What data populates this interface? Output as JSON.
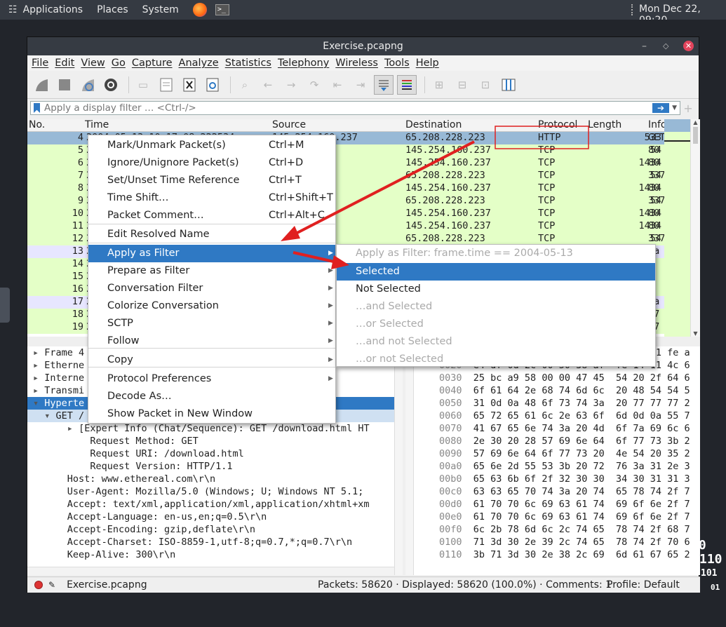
{
  "topbar": {
    "apps": "Applications",
    "places": "Places",
    "system": "System",
    "clock": "Mon Dec 22, 09:20"
  },
  "window": {
    "title": "Exercise.pcapng"
  },
  "menubar": [
    "File",
    "Edit",
    "View",
    "Go",
    "Capture",
    "Analyze",
    "Statistics",
    "Telephony",
    "Wireless",
    "Tools",
    "Help"
  ],
  "filter": {
    "placeholder": "Apply a display filter … <Ctrl-/>"
  },
  "columns": {
    "no": "No.",
    "time": "Time",
    "source": "Source",
    "destination": "Destination",
    "protocol": "Protocol",
    "length": "Length",
    "info": "Info"
  },
  "packets": [
    {
      "no": "4",
      "time": "2004-05-13 10:17:08.222534",
      "src": "145.254.160.237",
      "dst": "65.208.228.223",
      "proto": "HTTP",
      "len": "533",
      "info": "GET",
      "kind": "sel"
    },
    {
      "no": "5",
      "time": "2",
      "src": ".223",
      "dst": "145.254.160.237",
      "proto": "TCP",
      "len": "54",
      "info": "80",
      "kind": "http"
    },
    {
      "no": "6",
      "time": "2",
      "src": ".223",
      "dst": "145.254.160.237",
      "proto": "TCP",
      "len": "1434",
      "info": "80",
      "kind": "http"
    },
    {
      "no": "7",
      "time": "2",
      "src": "0.237",
      "dst": "65.208.228.223",
      "proto": "TCP",
      "len": "54",
      "info": "337",
      "kind": "http"
    },
    {
      "no": "8",
      "time": "2",
      "src": ".223",
      "dst": "145.254.160.237",
      "proto": "TCP",
      "len": "1434",
      "info": "80",
      "kind": "http"
    },
    {
      "no": "9",
      "time": "2",
      "src": "0.237",
      "dst": "65.208.228.223",
      "proto": "TCP",
      "len": "54",
      "info": "337",
      "kind": "http"
    },
    {
      "no": "10",
      "time": "2",
      "src": ".223",
      "dst": "145.254.160.237",
      "proto": "TCP",
      "len": "1434",
      "info": "80",
      "kind": "http"
    },
    {
      "no": "11",
      "time": "2",
      "src": ".223",
      "dst": "145.254.160.237",
      "proto": "TCP",
      "len": "1434",
      "info": "80",
      "kind": "http"
    },
    {
      "no": "12",
      "time": "2",
      "src": "0.237",
      "dst": "65.208.228.223",
      "proto": "TCP",
      "len": "54",
      "info": "337",
      "kind": "http"
    },
    {
      "no": "13",
      "time": "2",
      "src": "",
      "dst": "",
      "proto": "",
      "len": "",
      "info": "ta",
      "kind": "tcp"
    },
    {
      "no": "14",
      "time": "2",
      "src": "",
      "dst": "",
      "proto": "",
      "len": "",
      "info": "9",
      "kind": "http"
    },
    {
      "no": "15",
      "time": "2",
      "src": "",
      "dst": "",
      "proto": "",
      "len": "",
      "info": "0",
      "kind": "http"
    },
    {
      "no": "16",
      "time": "2",
      "src": "",
      "dst": "",
      "proto": "",
      "len": "",
      "info": "0",
      "kind": "http"
    },
    {
      "no": "17",
      "time": "2",
      "src": "",
      "dst": "",
      "proto": "",
      "len": "",
      "info": "ta",
      "kind": "tcp"
    },
    {
      "no": "18",
      "time": "2",
      "src": "",
      "dst": "",
      "proto": "",
      "len": "",
      "info": "37",
      "kind": "http"
    },
    {
      "no": "19",
      "time": "2",
      "src": "",
      "dst": "",
      "proto": "",
      "len": "",
      "info": "37",
      "kind": "http"
    }
  ],
  "details": [
    {
      "indent": "",
      "arrow": "▸",
      "text": "Frame 4"
    },
    {
      "indent": "",
      "arrow": "▸",
      "text": "Etherne                                 00:00), D"
    },
    {
      "indent": "",
      "arrow": "▸",
      "text": "Interne                                237, Dst:"
    },
    {
      "indent": "",
      "arrow": "▸",
      "text": "Transmi                                 Dst Port"
    },
    {
      "indent": "",
      "arrow": "▾",
      "text": "Hyperte"
    },
    {
      "indent": "  ",
      "arrow": "▾",
      "text": "GET /"
    },
    {
      "indent": "      ",
      "arrow": "▸",
      "text": "[Expert Info (Chat/Sequence): GET /download.html HT"
    },
    {
      "indent": "        ",
      "arrow": " ",
      "text": "Request Method: GET"
    },
    {
      "indent": "        ",
      "arrow": " ",
      "text": "Request URI: /download.html"
    },
    {
      "indent": "        ",
      "arrow": " ",
      "text": "Request Version: HTTP/1.1"
    },
    {
      "indent": "    ",
      "arrow": " ",
      "text": "Host: www.ethereal.com\\r\\n"
    },
    {
      "indent": "    ",
      "arrow": " ",
      "text": "User-Agent: Mozilla/5.0 (Windows; U; Windows NT 5.1;"
    },
    {
      "indent": "    ",
      "arrow": " ",
      "text": "Accept: text/xml,application/xml,application/xhtml+xm"
    },
    {
      "indent": "    ",
      "arrow": " ",
      "text": "Accept-Language: en-us,en;q=0.5\\r\\n"
    },
    {
      "indent": "    ",
      "arrow": " ",
      "text": "Accept-Encoding: gzip,deflate\\r\\n"
    },
    {
      "indent": "    ",
      "arrow": " ",
      "text": "Accept-Charset: ISO-8859-1,utf-8;q=0.7,*;q=0.7\\r\\n"
    },
    {
      "indent": "    ",
      "arrow": " ",
      "text": "Keep-Alive: 300\\r\\n"
    }
  ],
  "hex": [
    {
      "off": "0010",
      "bytes": "02 07 0f 45 40 00 80 06  90 10 91 fe a"
    },
    {
      "off": "0020",
      "bytes": "e4 df 0d 2c 00 50 38 af  fe 14 11 4c 6"
    },
    {
      "off": "0030",
      "bytes": "25 bc a9 58 00 00 47 45  54 20 2f 64 6"
    },
    {
      "off": "0040",
      "bytes": "6f 61 64 2e 68 74 6d 6c  20 48 54 54 5"
    },
    {
      "off": "0050",
      "bytes": "31 0d 0a 48 6f 73 74 3a  20 77 77 77 2"
    },
    {
      "off": "0060",
      "bytes": "65 72 65 61 6c 2e 63 6f  6d 0d 0a 55 7"
    },
    {
      "off": "0070",
      "bytes": "41 67 65 6e 74 3a 20 4d  6f 7a 69 6c 6"
    },
    {
      "off": "0080",
      "bytes": "2e 30 20 28 57 69 6e 64  6f 77 73 3b 2"
    },
    {
      "off": "0090",
      "bytes": "57 69 6e 64 6f 77 73 20  4e 54 20 35 2"
    },
    {
      "off": "00a0",
      "bytes": "65 6e 2d 55 53 3b 20 72  76 3a 31 2e 3"
    },
    {
      "off": "00b0",
      "bytes": "65 63 6b 6f 2f 32 30 30  34 30 31 31 3"
    },
    {
      "off": "00c0",
      "bytes": "63 63 65 70 74 3a 20 74  65 78 74 2f 7"
    },
    {
      "off": "00d0",
      "bytes": "61 70 70 6c 69 63 61 74  69 6f 6e 2f 7"
    },
    {
      "off": "00e0",
      "bytes": "61 70 70 6c 69 63 61 74  69 6f 6e 2f 7"
    },
    {
      "off": "00f0",
      "bytes": "6c 2b 78 6d 6c 2c 74 65  78 74 2f 68 7"
    },
    {
      "off": "0100",
      "bytes": "71 3d 30 2e 39 2c 74 65  78 74 2f 70 6"
    },
    {
      "off": "0110",
      "bytes": "3b 71 3d 30 2e 38 2c 69  6d 61 67 65 2"
    }
  ],
  "status": {
    "file": "Exercise.pcapng",
    "packets": "Packets: 58620 · Displayed: 58620 (100.0%) · Comments: 1",
    "profile": "Profile: Default"
  },
  "context_menu": [
    {
      "label": "Mark/Unmark Packet(s)",
      "shortcut": "Ctrl+M",
      "arrow": false
    },
    {
      "label": "Ignore/Unignore Packet(s)",
      "shortcut": "Ctrl+D",
      "arrow": false
    },
    {
      "label": "Set/Unset Time Reference",
      "shortcut": "Ctrl+T",
      "arrow": false
    },
    {
      "label": "Time Shift…",
      "shortcut": "Ctrl+Shift+T",
      "arrow": false
    },
    {
      "label": "Packet Comment…",
      "shortcut": "Ctrl+Alt+C",
      "arrow": false
    },
    {
      "label": "Edit Resolved Name",
      "shortcut": "",
      "arrow": false
    },
    {
      "label": "Apply as Filter",
      "shortcut": "",
      "arrow": true
    },
    {
      "label": "Prepare as Filter",
      "shortcut": "",
      "arrow": true
    },
    {
      "label": "Conversation Filter",
      "shortcut": "",
      "arrow": true
    },
    {
      "label": "Colorize Conversation",
      "shortcut": "",
      "arrow": true
    },
    {
      "label": "SCTP",
      "shortcut": "",
      "arrow": true
    },
    {
      "label": "Follow",
      "shortcut": "",
      "arrow": true
    },
    {
      "label": "Copy",
      "shortcut": "",
      "arrow": true
    },
    {
      "label": "Protocol Preferences",
      "shortcut": "",
      "arrow": true
    },
    {
      "label": "Decode As…",
      "shortcut": "",
      "arrow": false
    },
    {
      "label": "Show Packet in New Window",
      "shortcut": "",
      "arrow": false
    }
  ],
  "submenu": [
    {
      "label": "Apply as Filter: frame.time == 2004-05-13 10:17:08.222534",
      "disabled": true
    },
    {
      "label": "Selected",
      "disabled": false,
      "highlight": true
    },
    {
      "label": "Not Selected",
      "disabled": false
    },
    {
      "label": "…and Selected",
      "disabled": true
    },
    {
      "label": "…or Selected",
      "disabled": true
    },
    {
      "label": "…and not Selected",
      "disabled": true
    },
    {
      "label": "…or not Selected",
      "disabled": true
    }
  ],
  "colors": {
    "highlight": "#2f79c4",
    "selected_row": "#98b9d6",
    "http_row": "#e4ffc7",
    "tcp_row": "#e7e6ff",
    "annotation": "#e02020"
  }
}
